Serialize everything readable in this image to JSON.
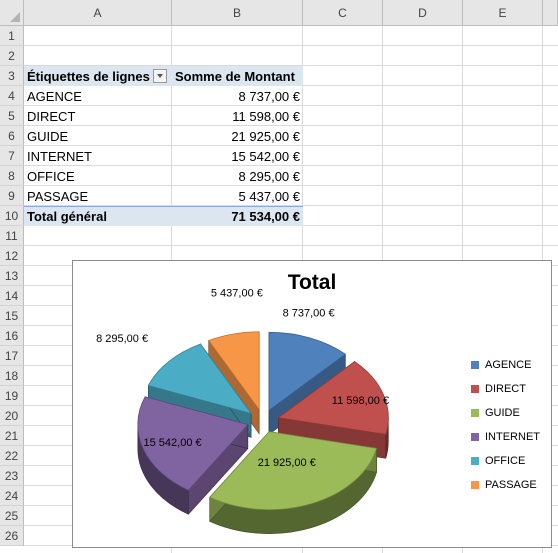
{
  "columns": [
    "A",
    "B",
    "C",
    "D",
    "E"
  ],
  "rows": [
    "1",
    "2",
    "3",
    "4",
    "5",
    "6",
    "7",
    "8",
    "9",
    "10",
    "11",
    "12",
    "13",
    "14",
    "15",
    "16",
    "17",
    "18",
    "19",
    "20",
    "21",
    "22",
    "23",
    "24",
    "25",
    "26"
  ],
  "pivot": {
    "header_label": "Étiquettes de lignes",
    "header_value": "Somme de Montant",
    "rows": [
      {
        "label": "AGENCE",
        "value": "8 737,00 €"
      },
      {
        "label": "DIRECT",
        "value": "11 598,00 €"
      },
      {
        "label": "GUIDE",
        "value": "21 925,00 €"
      },
      {
        "label": "INTERNET",
        "value": "15 542,00 €"
      },
      {
        "label": "OFFICE",
        "value": "8 295,00 €"
      },
      {
        "label": "PASSAGE",
        "value": "5 437,00 €"
      }
    ],
    "total_label": "Total général",
    "total_value": "71 534,00 €"
  },
  "chart_data": {
    "type": "pie",
    "title": "Total",
    "categories": [
      "AGENCE",
      "DIRECT",
      "GUIDE",
      "INTERNET",
      "OFFICE",
      "PASSAGE"
    ],
    "values": [
      8737,
      11598,
      21925,
      15542,
      8295,
      5437
    ],
    "data_labels": [
      "8 737,00 €",
      "11 598,00 €",
      "21 925,00 €",
      "15 542,00 €",
      "8 295,00 €",
      "5 437,00 €"
    ],
    "colors": [
      "#4f81bd",
      "#c0504d",
      "#9bbb59",
      "#8064a2",
      "#4bacc6",
      "#f79646"
    ],
    "exploded": true,
    "three_d": true,
    "legend_position": "right"
  }
}
